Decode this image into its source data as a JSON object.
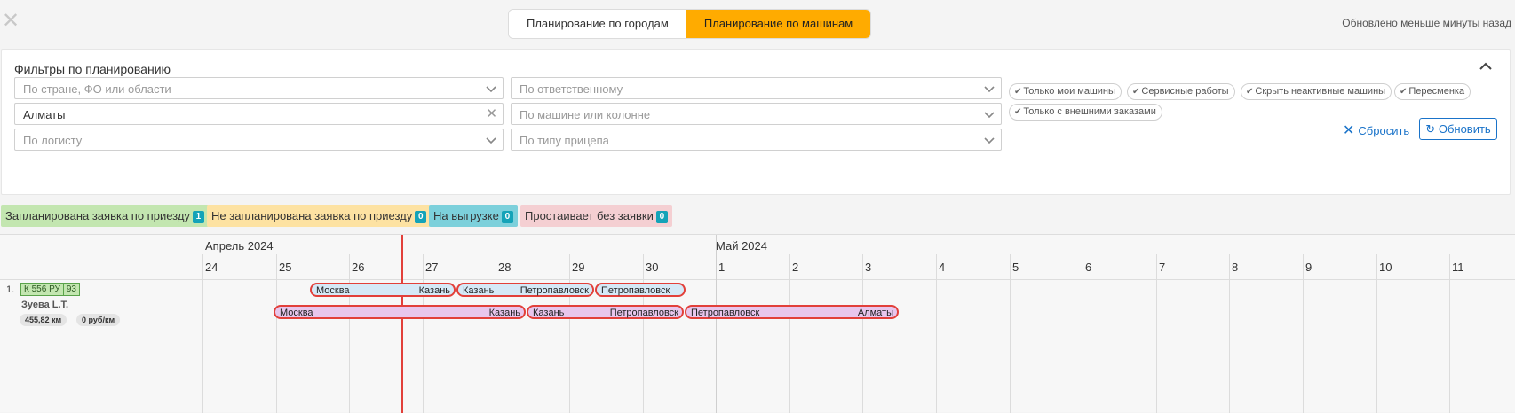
{
  "header": {
    "close_icon": "close-icon",
    "tabs": [
      {
        "label": "Планирование по городам",
        "active": false
      },
      {
        "label": "Планирование по машинам",
        "active": true
      }
    ],
    "updated": "Обновлено меньше минуты назад"
  },
  "filters": {
    "title": "Фильтры по планированию",
    "region_placeholder": "По стране, ФО или области",
    "city_value": "Алматы",
    "logist_placeholder": "По логисту",
    "responsible_placeholder": "По ответственному",
    "vehicle_placeholder": "По машине или колонне",
    "trailer_placeholder": "По типу прицепа",
    "chips": [
      "Только мои машины",
      "Сервисные работы",
      "Скрыть неактивные машины",
      "Пересменка",
      "Только с внешними заказами"
    ],
    "reset_label": "Сбросить",
    "refresh_label": "Обновить"
  },
  "legend": {
    "planned": {
      "label": "Запланирована заявка по приезду",
      "count": "1"
    },
    "unplanned": {
      "label": "Не запланирована заявка по приезду",
      "count": "0"
    },
    "unloading": {
      "label": "На выгрузке",
      "count": "0"
    },
    "idle": {
      "label": "Простаивает без заявки",
      "count": "0"
    }
  },
  "timeline": {
    "months": [
      "Апрель 2024",
      "Май 2024"
    ],
    "days": [
      "24",
      "25",
      "26",
      "27",
      "28",
      "29",
      "30",
      "1",
      "2",
      "3",
      "4",
      "5",
      "6",
      "7",
      "8",
      "9",
      "10",
      "11"
    ],
    "rows": [
      {
        "num": "1.",
        "plate": [
          "К 556 РУ",
          "93"
        ],
        "driver": "Зуева L.T.",
        "distance": "455,82 км",
        "rate": "0 руб/км",
        "bars_top": [
          {
            "from": "Москва",
            "to": "Казань"
          },
          {
            "from": "Казань",
            "to": "Петропавловск"
          },
          {
            "from": "Петропавловск",
            "to": ""
          }
        ],
        "bars_bottom": [
          {
            "from": "Москва",
            "to": "Казань"
          },
          {
            "from": "Казань",
            "to": "Петропавловск"
          },
          {
            "from": "Петропавловск",
            "to": "Алматы"
          }
        ]
      }
    ]
  },
  "colors": {
    "accent": "#ffab00",
    "link": "#1a73c9",
    "now_line": "#e2403a",
    "planned": "#c3e6b0",
    "unplanned": "#fde2a2",
    "unloading": "#7cd0db",
    "idle": "#f4cfd2"
  }
}
